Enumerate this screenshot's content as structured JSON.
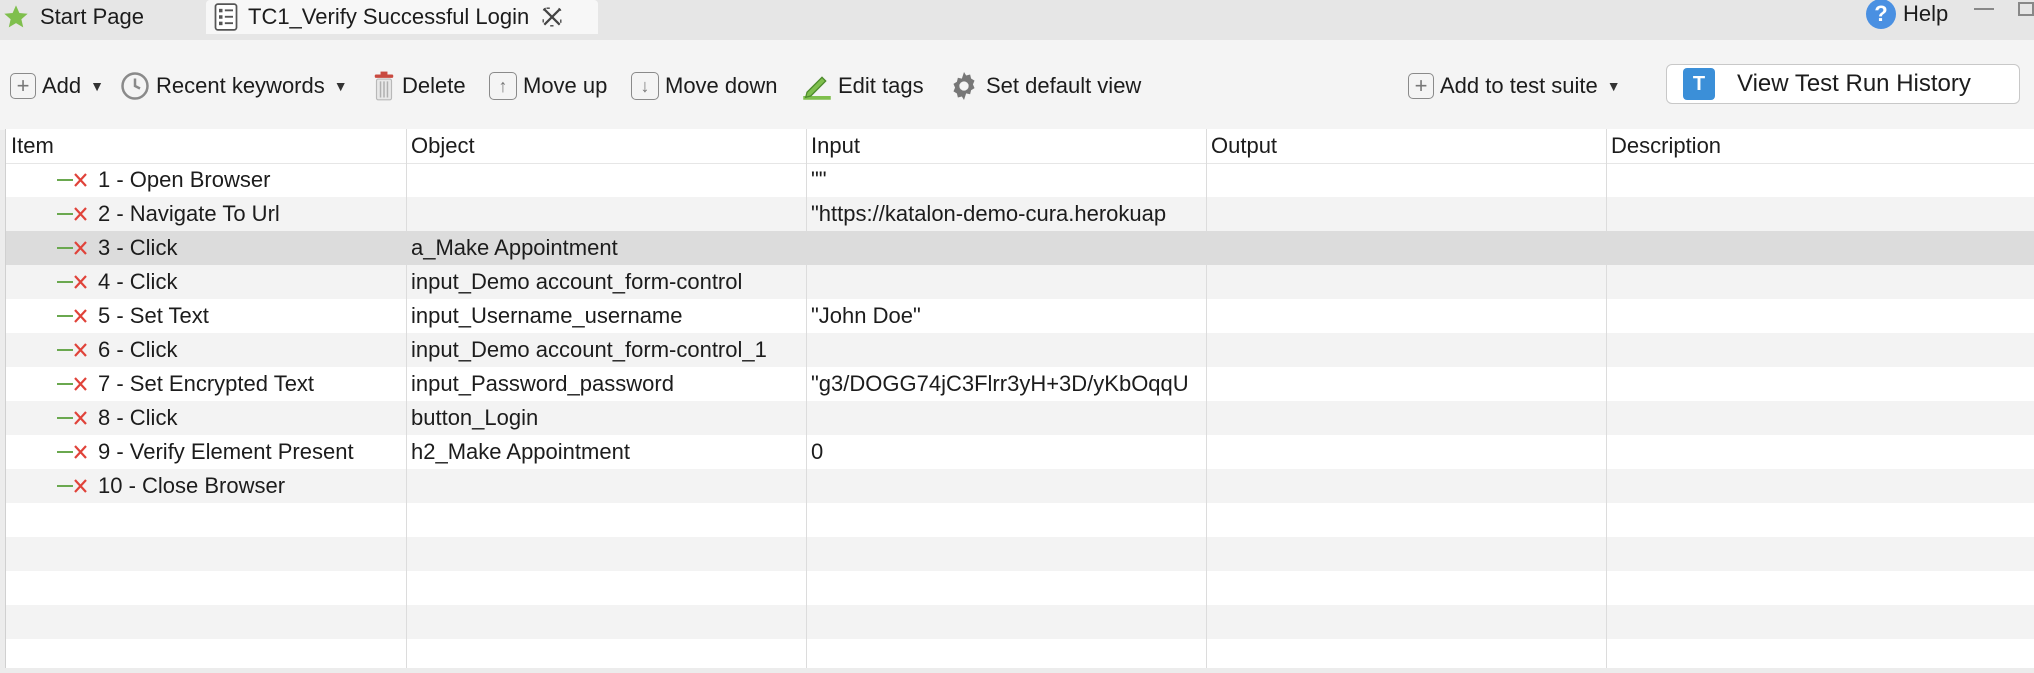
{
  "tabs": {
    "start_label": "Start Page",
    "active_label": "TC1_Verify Successful Login",
    "help_label": "Help"
  },
  "toolbar": {
    "add_label": "Add",
    "recent_label": "Recent keywords",
    "delete_label": "Delete",
    "move_up_label": "Move up",
    "move_down_label": "Move down",
    "edit_tags_label": "Edit tags",
    "default_view_label": "Set default view",
    "add_suite_label": "Add to test suite",
    "history_label": "View Test Run History"
  },
  "table": {
    "columns": [
      "Item",
      "Object",
      "Input",
      "Output",
      "Description"
    ],
    "rows": [
      {
        "item": "1 - Open Browser",
        "object": "",
        "input": "\"\"",
        "output": "",
        "description": ""
      },
      {
        "item": "2 - Navigate To Url",
        "object": "",
        "input": "\"https://katalon-demo-cura.herokuap",
        "output": "",
        "description": ""
      },
      {
        "item": "3 - Click",
        "object": "a_Make Appointment",
        "input": "",
        "output": "",
        "description": ""
      },
      {
        "item": "4 - Click",
        "object": "input_Demo account_form-control",
        "input": "",
        "output": "",
        "description": ""
      },
      {
        "item": "5 - Set Text",
        "object": "input_Username_username",
        "input": "\"John Doe\"",
        "output": "",
        "description": ""
      },
      {
        "item": "6 - Click",
        "object": "input_Demo account_form-control_1",
        "input": "",
        "output": "",
        "description": ""
      },
      {
        "item": "7 - Set Encrypted Text",
        "object": "input_Password_password",
        "input": "\"g3/DOGG74jC3Flrr3yH+3D/yKbOqqU",
        "output": "",
        "description": ""
      },
      {
        "item": "8 - Click",
        "object": "button_Login",
        "input": "",
        "output": "",
        "description": ""
      },
      {
        "item": "9 - Verify Element Present",
        "object": "h2_Make Appointment",
        "input": "0",
        "output": "",
        "description": ""
      },
      {
        "item": "10 - Close Browser",
        "object": "",
        "input": "",
        "output": "",
        "description": ""
      }
    ],
    "selected_row": 2
  },
  "colors": {
    "step_icon": "#e0433a",
    "step_line": "#6aa84f",
    "selected_row": "#dcdcdc",
    "alt_row": "#f3f3f3"
  }
}
